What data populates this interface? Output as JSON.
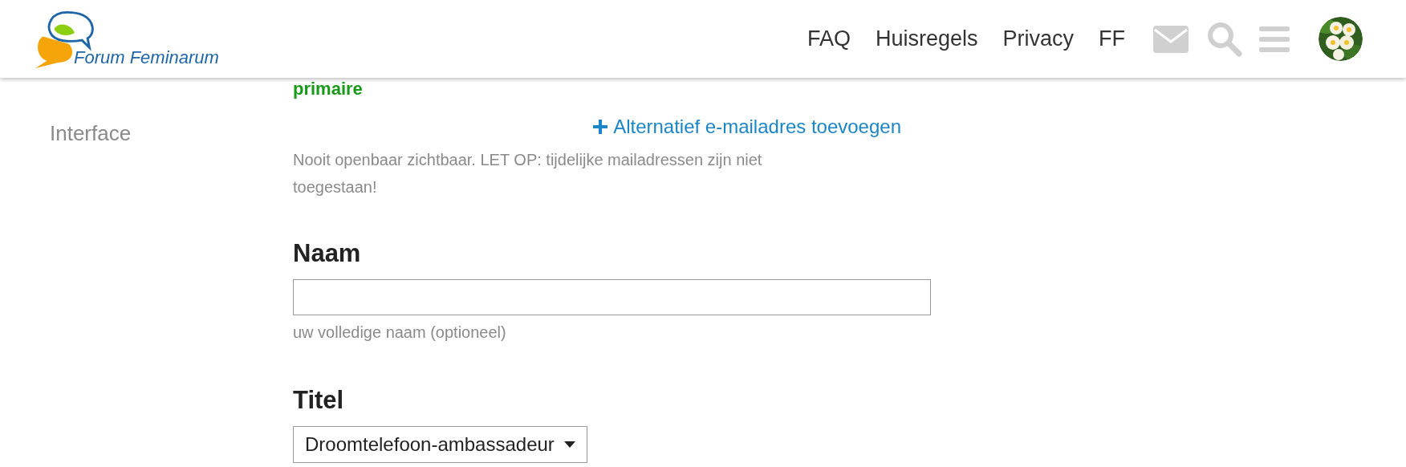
{
  "header": {
    "logo": {
      "text": "Forum Feminarum"
    },
    "nav_links": [
      "FAQ",
      "Huisregels",
      "Privacy",
      "FF"
    ]
  },
  "sidebar": {
    "items": [
      {
        "label": "Interface"
      }
    ]
  },
  "email": {
    "status": "primaire",
    "add_link": "Alternatief e-mailadres toevoegen",
    "help": "Nooit openbaar zichtbaar. LET OP: tijdelijke mailadressen zijn niet toegestaan!"
  },
  "name_field": {
    "label": "Naam",
    "hint": "uw volledige naam (optioneel)"
  },
  "title_field": {
    "label": "Titel",
    "value": "Droomtelefoon-ambassadeur"
  }
}
